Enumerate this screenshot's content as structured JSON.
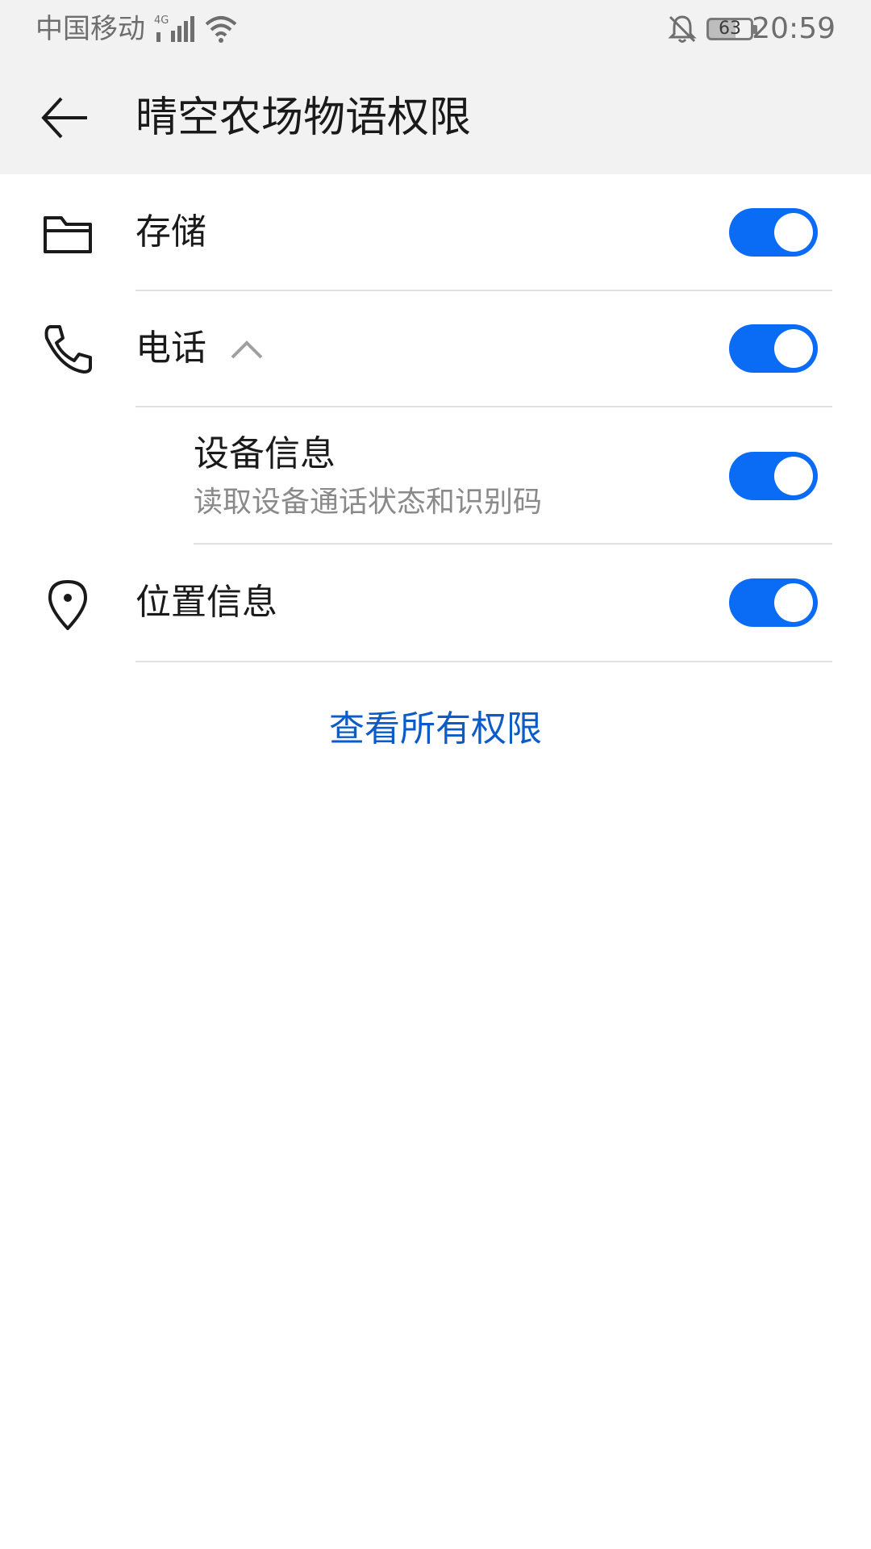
{
  "status_bar": {
    "carrier": "中国移动",
    "network": "4G",
    "battery": "63",
    "battery_level": 0.63,
    "time": "20:59",
    "icons": [
      "signal-icon",
      "wifi-icon",
      "bell-off-icon",
      "battery-icon"
    ]
  },
  "app_bar": {
    "title": "晴空农场物语权限",
    "back_icon": "arrow-left-icon"
  },
  "permissions": [
    {
      "label": "存储",
      "icon": "folder-icon",
      "enabled": true
    },
    {
      "label": "电话",
      "icon": "phone-icon",
      "enabled": true,
      "expanded": true,
      "children": [
        {
          "title": "设备信息",
          "description": "读取设备通话状态和识别码",
          "enabled": true
        }
      ]
    },
    {
      "label": "位置信息",
      "icon": "location-pin-icon",
      "enabled": true
    }
  ],
  "footer": {
    "view_all_label": "查看所有权限"
  },
  "colors": {
    "accent": "#0a6cf5",
    "link": "#0b5cc8",
    "header_bg": "#f2f2f2",
    "divider": "#e0e0e0"
  }
}
